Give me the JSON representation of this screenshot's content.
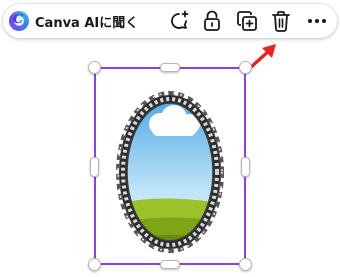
{
  "toolbar": {
    "ai_button_label": "Canva AIに聞く",
    "ai_logo_letter": "C",
    "icons": [
      "comment-add-icon",
      "lock-icon",
      "duplicate-icon",
      "trash-icon",
      "more-icon"
    ]
  },
  "canvas": {
    "selected_element": "ornate-oval-mirror-frame",
    "selection_color": "#8b3dff"
  },
  "annotation": {
    "arrow_color": "#e8221c",
    "points_to": "trash-icon"
  }
}
